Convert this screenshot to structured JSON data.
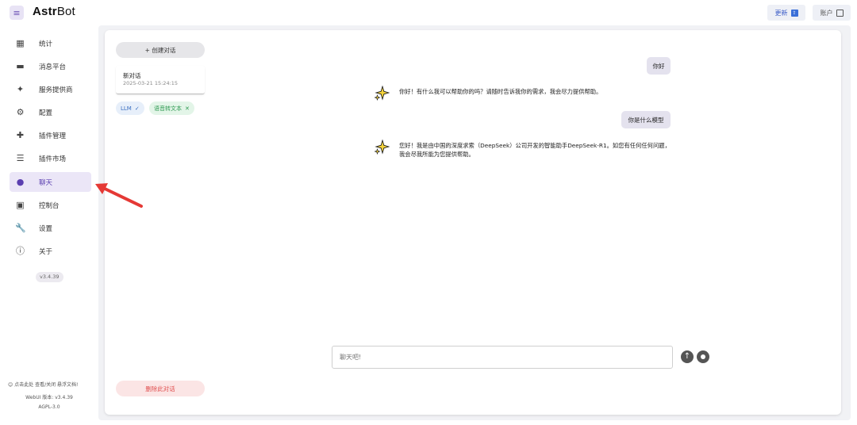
{
  "app": {
    "brand_bold": "Astr",
    "brand_light": "Bot"
  },
  "topbar": {
    "update_label": "更新",
    "account_label": "账户"
  },
  "sidebar": {
    "items": [
      {
        "label": "统计",
        "icon": "dashboard-icon",
        "glyph": "▦"
      },
      {
        "label": "消息平台",
        "icon": "message-icon",
        "glyph": "▬"
      },
      {
        "label": "服务提供商",
        "icon": "sparkle-icon",
        "glyph": "✦"
      },
      {
        "label": "配置",
        "icon": "gear-icon",
        "glyph": "⚙"
      },
      {
        "label": "插件管理",
        "icon": "puzzle-icon",
        "glyph": "✚"
      },
      {
        "label": "插件市场",
        "icon": "store-icon",
        "glyph": "☰"
      },
      {
        "label": "聊天",
        "icon": "chat-icon",
        "glyph": "●"
      },
      {
        "label": "控制台",
        "icon": "terminal-icon",
        "glyph": "▣"
      },
      {
        "label": "设置",
        "icon": "wrench-icon",
        "glyph": "🔧"
      },
      {
        "label": "关于",
        "icon": "info-icon",
        "glyph": "ⓘ"
      }
    ],
    "active_index": 6,
    "version": "v3.4.39",
    "footer_hint": "😊 点击此处 查看/关闭 悬浮文档!",
    "webui_version": "WebUI 版本: v3.4.39",
    "license": "AGPL-3.0"
  },
  "conversations": {
    "new_chat_label": "+ 创建对话",
    "items": [
      {
        "title": "新对话",
        "time": "2025-03-21 15:24:15"
      }
    ],
    "chips": {
      "llm": "LLM",
      "tts": "语音转文本"
    },
    "delete_label": "删除此对话"
  },
  "messages": {
    "user_1": "你好",
    "bot_1": "你好！有什么我可以帮助你的吗？请随时告诉我你的需求，我会尽力提供帮助。",
    "user_2": "你是什么模型",
    "bot_2": "您好！我是由中国的深度求索（DeepSeek）公司开发的智能助手DeepSeek-R1。如您有任何任何问题，我会尽我所能为您提供帮助。"
  },
  "input": {
    "placeholder": "聊天吧!"
  },
  "colors": {
    "accent": "#5b3fb0",
    "annotation_arrow": "#e53935"
  }
}
